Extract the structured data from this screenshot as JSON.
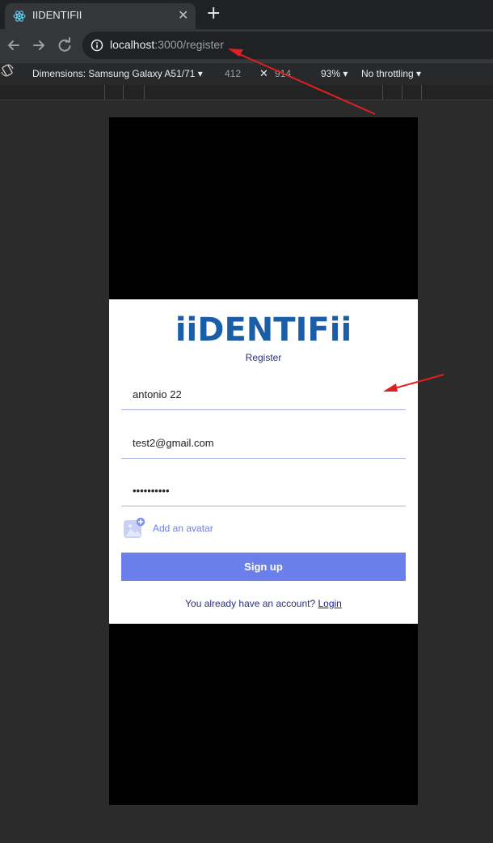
{
  "browser": {
    "tab_title": "IIDENTIFII",
    "url_host": "localhost",
    "url_path": ":3000/register"
  },
  "devtools": {
    "dimensions_label": "Dimensions: Samsung Galaxy A51/71 ▾",
    "width": "412",
    "separator": "✕",
    "height": "914",
    "zoom": "93% ▾",
    "throttling": "No throttling ▾"
  },
  "app": {
    "logo_text": "iiDENTIFii",
    "subtitle": "Register",
    "username_value": "antonio 22",
    "email_value": "test2@gmail.com",
    "password_value": "antonio123",
    "avatar_label": "Add an avatar",
    "signup_label": "Sign up",
    "already_text": "You already have an account?",
    "login_link": "Login"
  },
  "colors": {
    "accent": "#6b7fea",
    "logo_blue": "#1a5ea8",
    "annotation_red": "#e02020"
  }
}
